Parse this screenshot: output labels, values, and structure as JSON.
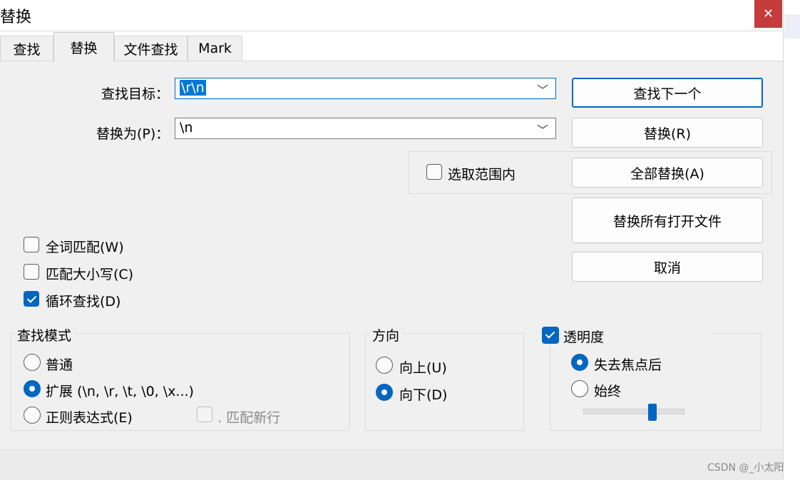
{
  "window": {
    "title": "替换",
    "close_glyph": "✕"
  },
  "tabs": [
    {
      "label": "查找"
    },
    {
      "label": "替换"
    },
    {
      "label": "文件查找"
    },
    {
      "label": "Mark"
    }
  ],
  "find": {
    "label": "查找目标：",
    "value": "\\r\\n"
  },
  "replace": {
    "label": "替换为(P)：",
    "value": "\\n"
  },
  "buttons": {
    "find_next": "查找下一个",
    "replace": "替换(R)",
    "replace_all": "全部替换(A)",
    "replace_all_open": "替换所有打开文件",
    "cancel": "取消"
  },
  "in_selection": {
    "label": "选取范围内",
    "checked": false
  },
  "options": {
    "whole_word": "全词匹配(W)",
    "match_case": "匹配大小写(C)",
    "wrap_around": "循环查找(D)"
  },
  "search_mode": {
    "title": "查找模式",
    "normal": "普通",
    "extended": "扩展 (\\n, \\r, \\t, \\0, \\x...)",
    "regex": "正则表达式(E)",
    "dot_newline": ". 匹配新行"
  },
  "direction": {
    "title": "方向",
    "up": "向上(U)",
    "down": "向下(D)"
  },
  "transparency": {
    "title": "透明度",
    "on_lose_focus": "失去焦点后",
    "always": "始终",
    "level": 0.7
  },
  "watermark": "CSDN @_小太阳",
  "colors": {
    "accent": "#0067c0",
    "close": "#c43c3c"
  }
}
